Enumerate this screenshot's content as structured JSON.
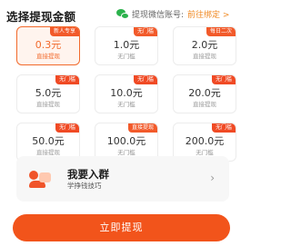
{
  "header": {
    "title": "选择提现金额",
    "wechat_label": "提现微信账号:",
    "bind_link": "前往绑定 >"
  },
  "options": [
    {
      "amount": "0.3元",
      "sub": "直接提现",
      "badge": "新人专享",
      "selected": true
    },
    {
      "amount": "1.0元",
      "sub": "无门槛",
      "badge": "无门槛",
      "selected": false
    },
    {
      "amount": "2.0元",
      "sub": "直接提现",
      "badge": "每日二次",
      "selected": false
    },
    {
      "amount": "5.0元",
      "sub": "直接提现",
      "badge": "无门槛",
      "selected": false
    },
    {
      "amount": "10.0元",
      "sub": "无门槛",
      "badge": "无门槛",
      "selected": false
    },
    {
      "amount": "20.0元",
      "sub": "直接提现",
      "badge": "无门槛",
      "selected": false
    },
    {
      "amount": "50.0元",
      "sub": "直接提现",
      "badge": "无门槛",
      "selected": false
    },
    {
      "amount": "100.0元",
      "sub": "无门槛",
      "badge": "直接提现",
      "selected": false
    },
    {
      "amount": "200.0元",
      "sub": "无门槛",
      "badge": "无门槛",
      "selected": false
    }
  ],
  "group": {
    "title": "我要入群",
    "subtitle": "学挣钱技巧"
  },
  "withdraw_button": "立即提现",
  "colors": {
    "accent": "#f2541b",
    "selected_bg": "#fff4ee",
    "wechat_green": "#2bb24c"
  }
}
